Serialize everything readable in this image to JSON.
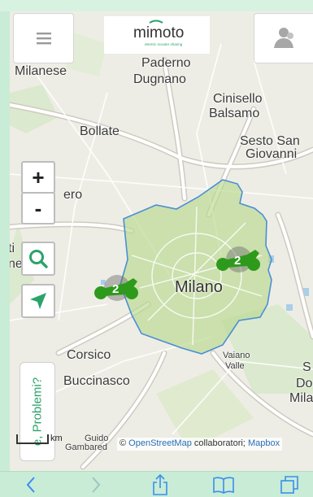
{
  "header": {
    "logo_text": "mimoto",
    "logo_tagline": "electric scooter sharing"
  },
  "map": {
    "places": {
      "milanese": "Milanese",
      "paderno": "Paderno",
      "dugnano": "Dugnano",
      "cinisello": "Cinisello",
      "balsamo": "Balsamo",
      "bollate": "Bollate",
      "sesto_san": "Sesto San",
      "giovanni": "Giovanni",
      "pero": "ero",
      "rho_ti": "ti",
      "rho_nese": "nese",
      "milano": "Milano",
      "corsico": "Corsico",
      "buccinasco": "Buccinasco",
      "opera_s": "S",
      "do": "Do",
      "mila": "Mila",
      "vaiano": "Vaiano",
      "valle": "Valle",
      "guido": "Guido",
      "gambared": "Gambared"
    },
    "scooters": [
      {
        "count": "2"
      },
      {
        "count": "2"
      }
    ],
    "zoom_in_label": "+",
    "zoom_out_label": "-",
    "scale_label": "km",
    "attribution": {
      "prefix": "©",
      "osm": "OpenStreetMap",
      "middle": "collaboratori;",
      "mapbox": "Mapbox"
    }
  },
  "problems_tab_label": "e, Problemi?",
  "colors": {
    "brand_green": "#2aa36b",
    "zone_fill": "#b9d98f",
    "zone_border": "#4a8fd4",
    "scooter_green": "#2e9a1c",
    "toolbar_bg": "#c8ecd6",
    "toolbar_icon": "#3b8ef0"
  },
  "toolbar": {
    "back_icon": "chevron-left-icon",
    "forward_icon": "chevron-right-icon",
    "share_icon": "share-icon",
    "bookmarks_icon": "book-icon",
    "tabs_icon": "tabs-icon"
  }
}
